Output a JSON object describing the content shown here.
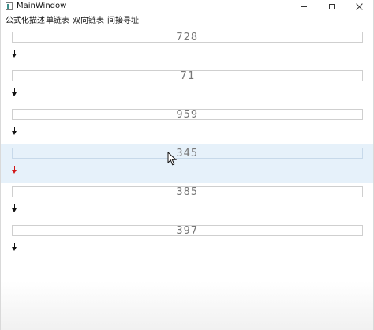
{
  "window": {
    "title": "MainWindow"
  },
  "menu": {
    "items": [
      {
        "label": "公式化描述"
      },
      {
        "label": "单链表"
      },
      {
        "label": "双向链表"
      },
      {
        "label": "间接寻址"
      }
    ]
  },
  "nodes": [
    {
      "value": "728"
    },
    {
      "value": "71"
    },
    {
      "value": "959"
    },
    {
      "value": "345"
    },
    {
      "value": "385"
    },
    {
      "value": "397"
    }
  ],
  "icons": {
    "app": "window-app-icon",
    "minimize": "minimize-icon",
    "maximize": "maximize-icon",
    "close": "close-icon",
    "arrow": "arrow-down-icon",
    "cursor": "mouse-cursor-icon"
  },
  "colors": {
    "highlight_row": "#e6f1fa",
    "active_arrow": "#d11717",
    "normal_arrow": "#111111"
  }
}
